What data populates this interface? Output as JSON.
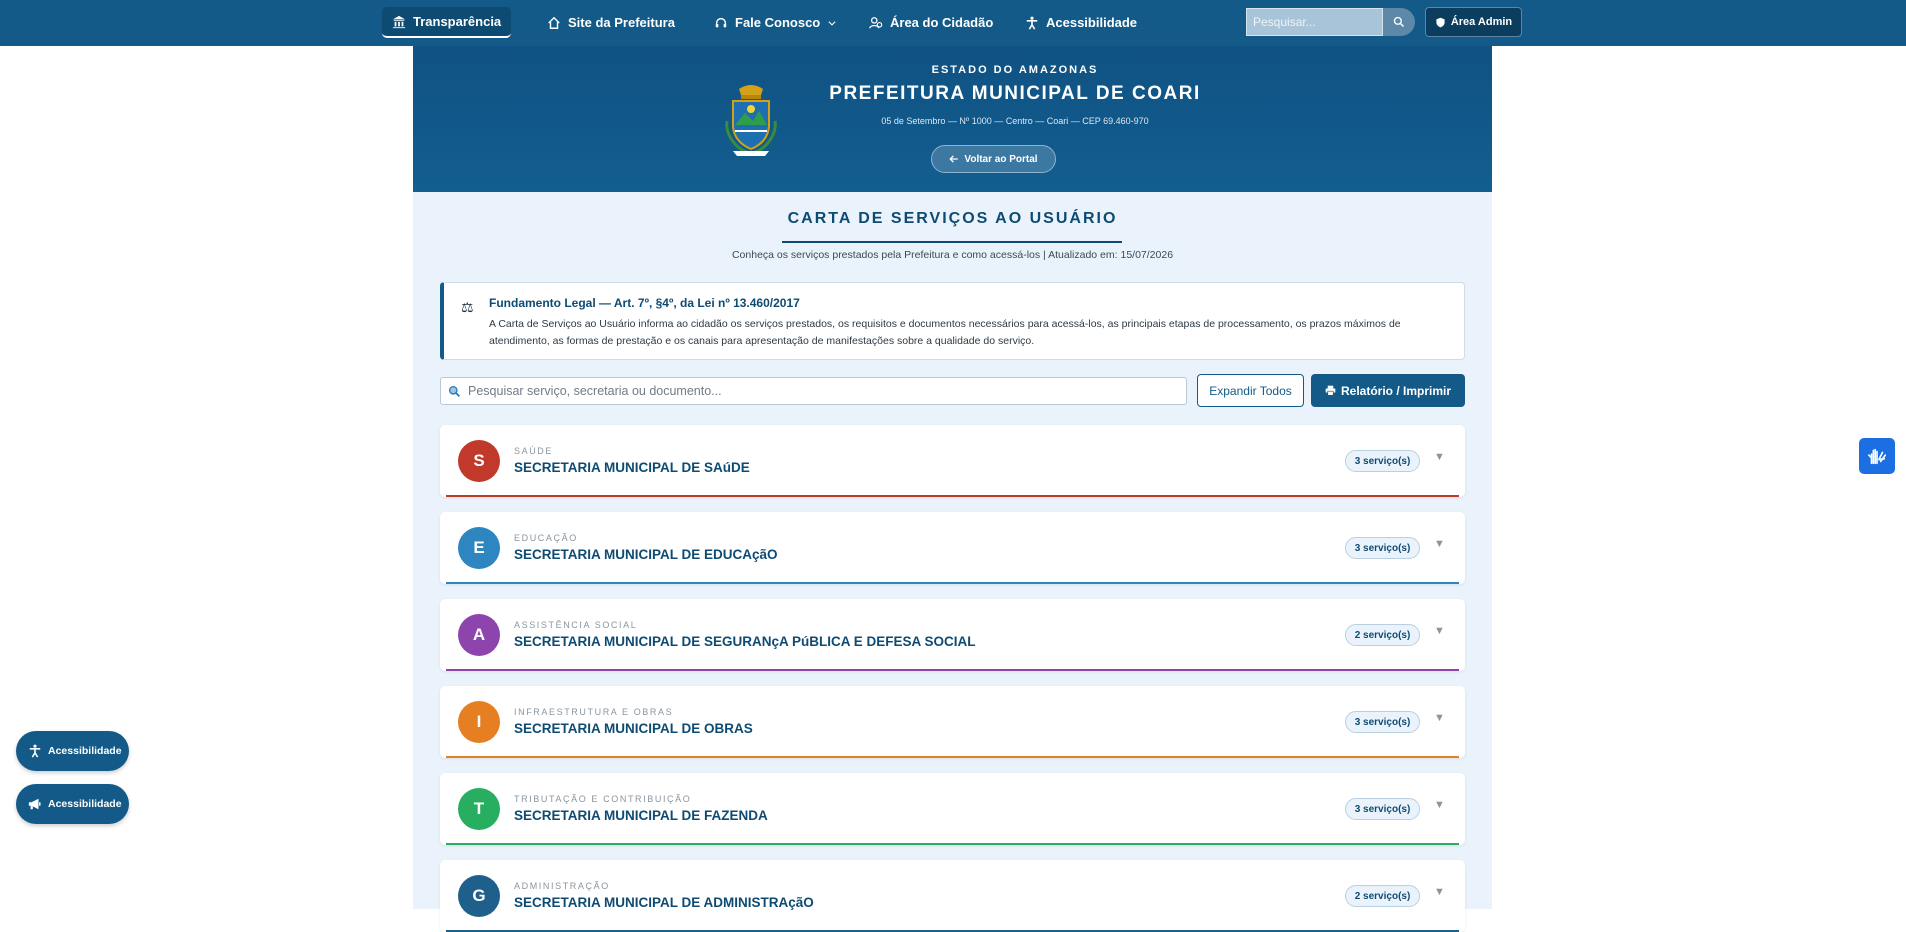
{
  "nav": {
    "items": [
      {
        "label": "Transparência",
        "icon": "bank-icon"
      },
      {
        "label": "Site da Prefeitura",
        "icon": "home-icon"
      },
      {
        "label": "Fale Conosco",
        "icon": "headset-icon"
      },
      {
        "label": "Área do Cidadão",
        "icon": "users-icon"
      },
      {
        "label": "Acessibilidade",
        "icon": "accessibility-icon"
      }
    ],
    "search_placeholder": "Pesquisar...",
    "admin_label": "Área Admin"
  },
  "header": {
    "state": "ESTADO DO AMAZONAS",
    "city": "PREFEITURA MUNICIPAL DE COARI",
    "address": "05 de Setembro — Nº 1000 — Centro — Coari — CEP 69.460-970",
    "back_label": "Voltar ao Portal"
  },
  "page": {
    "title": "CARTA DE SERVIÇOS AO USUÁRIO",
    "subtitle": "Conheça os serviços prestados pela Prefeitura e como acessá-los  |  Atualizado em: 15/07/2026"
  },
  "legal": {
    "heading": "Fundamento Legal — Art. 7º, §4º, da Lei nº 13.460/2017",
    "body": "A Carta de Serviços ao Usuário informa ao cidadão os serviços prestados, os requisitos e documentos necessários para acessá-los, as principais etapas de processamento, os prazos máximos de atendimento, as formas de prestação e os canais para apresentação de manifestações sobre a qualidade do serviço."
  },
  "toolbar": {
    "search_placeholder": "Pesquisar serviço, secretaria ou documento...",
    "expand_label": "Expandir Todos",
    "report_label": "Relatório / Imprimir"
  },
  "secretarias": [
    {
      "letter": "S",
      "category": "SAÚDE",
      "name": "SECRETARIA MUNICIPAL DE SAúDE",
      "count": "3 serviço(s)",
      "color": "#c0392b"
    },
    {
      "letter": "E",
      "category": "EDUCAÇÃO",
      "name": "SECRETARIA MUNICIPAL DE EDUCAçãO",
      "count": "3 serviço(s)",
      "color": "#2e86c1"
    },
    {
      "letter": "A",
      "category": "ASSISTÊNCIA SOCIAL",
      "name": "SECRETARIA MUNICIPAL DE SEGURANçA PúBLICA E DEFESA SOCIAL",
      "count": "2 serviço(s)",
      "color": "#8e44ad"
    },
    {
      "letter": "I",
      "category": "INFRAESTRUTURA E OBRAS",
      "name": "SECRETARIA MUNICIPAL DE OBRAS",
      "count": "3 serviço(s)",
      "color": "#e67e22"
    },
    {
      "letter": "T",
      "category": "TRIBUTAÇÃO E CONTRIBUIÇÃO",
      "name": "SECRETARIA MUNICIPAL DE FAZENDA",
      "count": "3 serviço(s)",
      "color": "#27ae60"
    },
    {
      "letter": "G",
      "category": "ADMINISTRAÇÃO",
      "name": "SECRETARIA MUNICIPAL DE ADMINISTRAçãO",
      "count": "2 serviço(s)",
      "color": "#1f5f8b"
    }
  ],
  "floating": {
    "accessibility_label_1": "Acessibilidade",
    "accessibility_label_2": "Acessibilidade"
  }
}
